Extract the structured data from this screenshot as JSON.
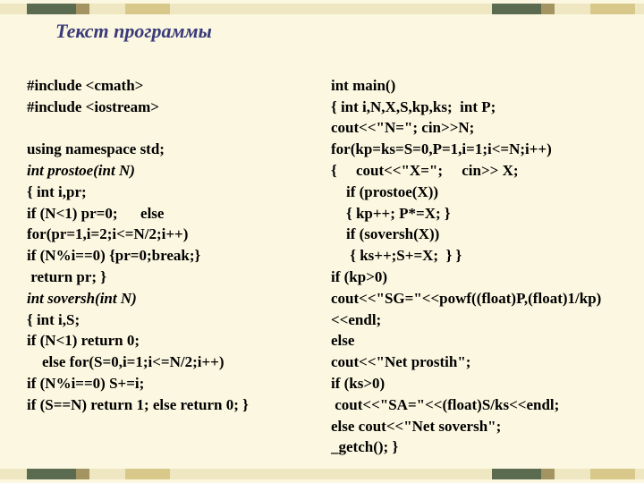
{
  "title": "Текст программы",
  "left": {
    "l1": "#include <cmath>",
    "l2": "#include <iostream>",
    "l3": "using namespace std;",
    "l4": "int prostoe(int N)",
    "l5": "{ int i,pr;",
    "l6": "if (N<1) pr=0;      else",
    "l7": "for(pr=1,i=2;i<=N/2;i++)",
    "l8": "if (N%i==0) {pr=0;break;}",
    "l9": " return pr; }",
    "l10": "int soversh(int N)",
    "l11": "{ int i,S;",
    "l12": "if (N<1) return 0;",
    "l13": "    else for(S=0,i=1;i<=N/2;i++)",
    "l14": "if (N%i==0) S+=i;",
    "l15": "if (S==N) return 1; else return 0; }"
  },
  "right": {
    "r1": "int main()",
    "r2": "{ int i,N,X,S,kp,ks;  int P;",
    "r3": "cout<<\"N=\"; cin>>N;",
    "r4": "for(kp=ks=S=0,P=1,i=1;i<=N;i++)",
    "r5": "{     cout<<\"X=\";     cin>> X;",
    "r6": "    if (prostoe(X))",
    "r7": "    { kp++; P*=X; }",
    "r8": "    if (soversh(X))",
    "r9": "     { ks++;S+=X;  } }",
    "r10": "if (kp>0)",
    "r11": "cout<<\"SG=\"<<powf((float)P,(float)1/kp)<<endl;",
    "r12": "else",
    "r13": "cout<<\"Net prostih\";",
    "r14": "if (ks>0)",
    "r15": " cout<<\"SA=\"<<(float)S/ks<<endl;",
    "r16": "else cout<<\"Net soversh\";",
    "r17": "_getch(); }"
  }
}
